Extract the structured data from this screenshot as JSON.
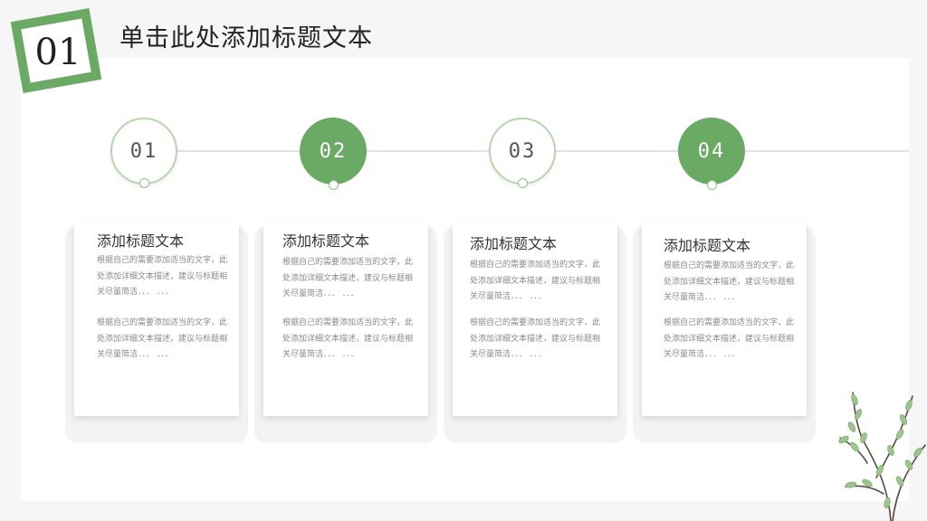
{
  "header": {
    "badge_number": "01",
    "title": "单击此处添加标题文本"
  },
  "colors": {
    "accent": "#6aaa64",
    "accent_light": "#b6d6ae",
    "text_dark": "#222222",
    "text_muted": "#8a8a8a"
  },
  "steps": [
    {
      "label": "01",
      "style": "outline"
    },
    {
      "label": "02",
      "style": "filled"
    },
    {
      "label": "03",
      "style": "outline"
    },
    {
      "label": "04",
      "style": "filled"
    }
  ],
  "cards": [
    {
      "title": "添加标题文本",
      "paragraphs": [
        "根据自己的需要添加适当的文字，此处添加详细文本描述，建议与标题相关尽量简洁．．．  ．．．",
        "根据自己的需要添加适当的文字，此处添加详细文本描述，建议与标题相关尽量简洁．．．  ．．．"
      ]
    },
    {
      "title": "添加标题文本",
      "paragraphs": [
        "根据自己的需要添加适当的文字，此处添加详细文本描述，建议与标题相关尽量简洁．．．  ．．．",
        "根据自己的需要添加适当的文字，此处添加详细文本描述，建议与标题相关尽量简洁．．．  ．．．"
      ]
    },
    {
      "title": "添加标题文本",
      "paragraphs": [
        "根据自己的需要添加适当的文字，此处添加详细文本描述，建议与标题相关尽量简洁．．．  ．．．",
        "根据自己的需要添加适当的文字，此处添加详细文本描述，建议与标题相关尽量简洁．．．  ．．．"
      ]
    },
    {
      "title": "添加标题文本",
      "paragraphs": [
        "根据自己的需要添加适当的文字，此处添加详细文本描述，建议与标题相关尽量简洁．．．  ．．．",
        "根据自己的需要添加适当的文字，此处添加详细文本描述，建议与标题相关尽量简洁．．．  ．．．"
      ]
    }
  ]
}
